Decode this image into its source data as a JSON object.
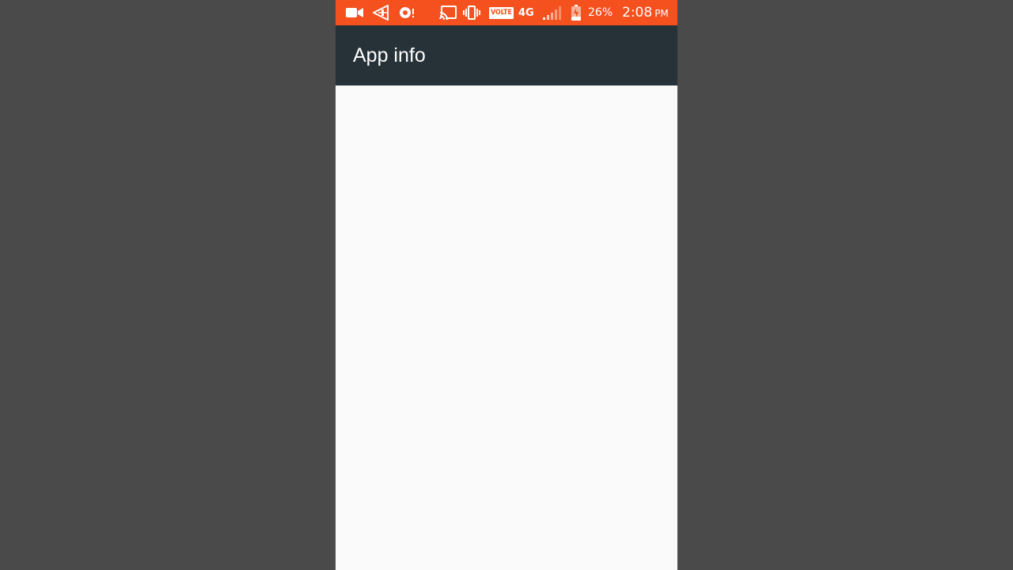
{
  "status_bar": {
    "icons": [
      "video-camera-icon",
      "send-icon",
      "screen-recorder-icon",
      "cast-icon",
      "vibrate-icon",
      "signal-icon",
      "battery-charging-icon"
    ],
    "volte_label": "VOLTE",
    "network_type": "4G",
    "battery_percent": "26%",
    "time": "2:08",
    "ampm": "PM"
  },
  "app_bar": {
    "title": "App info"
  },
  "colors": {
    "status_bar": "#f4511e",
    "app_bar": "#263238",
    "content_bg": "#fafafa",
    "page_bg": "#4a4a4a"
  }
}
